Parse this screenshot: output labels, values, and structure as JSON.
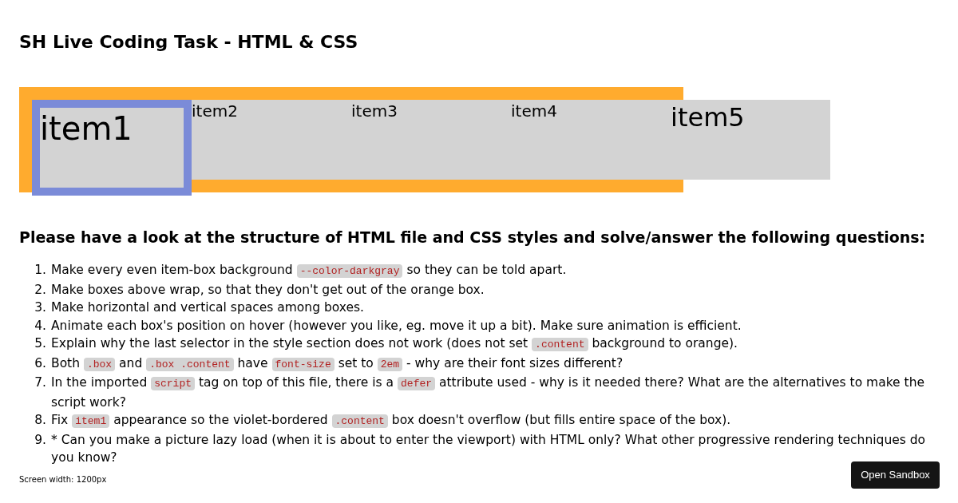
{
  "title": "SH Live Coding Task - HTML & CSS",
  "boxes": [
    {
      "label": "item1",
      "kind": "bordered"
    },
    {
      "label": "item2",
      "kind": "plain"
    },
    {
      "label": "item3",
      "kind": "plain"
    },
    {
      "label": "item4",
      "kind": "plain"
    },
    {
      "label": "item5",
      "kind": "large"
    }
  ],
  "heading": "Please have a look at the structure of HTML file and CSS styles and solve/answer the following questions:",
  "questions": [
    {
      "number": "1.",
      "parts": [
        {
          "kind": "text",
          "text": "Make every even item-box background "
        },
        {
          "kind": "code",
          "text": "--color-darkgray"
        },
        {
          "kind": "text",
          "text": " so they can be told apart."
        }
      ]
    },
    {
      "number": "2.",
      "parts": [
        {
          "kind": "text",
          "text": "Make boxes above wrap, so that they don't get out of the orange box."
        }
      ]
    },
    {
      "number": "3.",
      "parts": [
        {
          "kind": "text",
          "text": "Make horizontal and vertical spaces among boxes."
        }
      ]
    },
    {
      "number": "4.",
      "parts": [
        {
          "kind": "text",
          "text": "Animate each box's position on hover (however you like, eg. move it up a bit). Make sure animation is efficient."
        }
      ]
    },
    {
      "number": "5.",
      "parts": [
        {
          "kind": "text",
          "text": "Explain why the last selector in the style section does not work (does not set "
        },
        {
          "kind": "code",
          "text": ".content"
        },
        {
          "kind": "text",
          "text": " background to orange)."
        }
      ]
    },
    {
      "number": "6.",
      "parts": [
        {
          "kind": "text",
          "text": "Both "
        },
        {
          "kind": "code",
          "text": ".box"
        },
        {
          "kind": "text",
          "text": " and "
        },
        {
          "kind": "code",
          "text": ".box .content"
        },
        {
          "kind": "text",
          "text": " have "
        },
        {
          "kind": "code",
          "text": "font-size"
        },
        {
          "kind": "text",
          "text": " set to "
        },
        {
          "kind": "code",
          "text": "2em"
        },
        {
          "kind": "text",
          "text": " - why are their font sizes different?"
        }
      ]
    },
    {
      "number": "7.",
      "parts": [
        {
          "kind": "text",
          "text": "In the imported "
        },
        {
          "kind": "code",
          "text": "script"
        },
        {
          "kind": "text",
          "text": " tag on top of this file, there is a "
        },
        {
          "kind": "code",
          "text": "defer"
        },
        {
          "kind": "text",
          "text": " attribute used - why is it needed there? What are the alternatives to make the script work?"
        }
      ]
    },
    {
      "number": "8.",
      "parts": [
        {
          "kind": "text",
          "text": "Fix "
        },
        {
          "kind": "code",
          "text": "item1"
        },
        {
          "kind": "text",
          "text": " appearance so the violet-bordered "
        },
        {
          "kind": "code",
          "text": ".content"
        },
        {
          "kind": "text",
          "text": " box doesn't overflow (but fills entire space of the box)."
        }
      ]
    },
    {
      "number": "9.",
      "parts": [
        {
          "kind": "text",
          "text": "* Can you make a picture lazy load (when it is about to enter the viewport) with HTML only? What other progressive rendering techniques do you know?"
        }
      ]
    }
  ],
  "footer": "Screen width: 1200px",
  "sandbox_button": "Open Sandbox"
}
